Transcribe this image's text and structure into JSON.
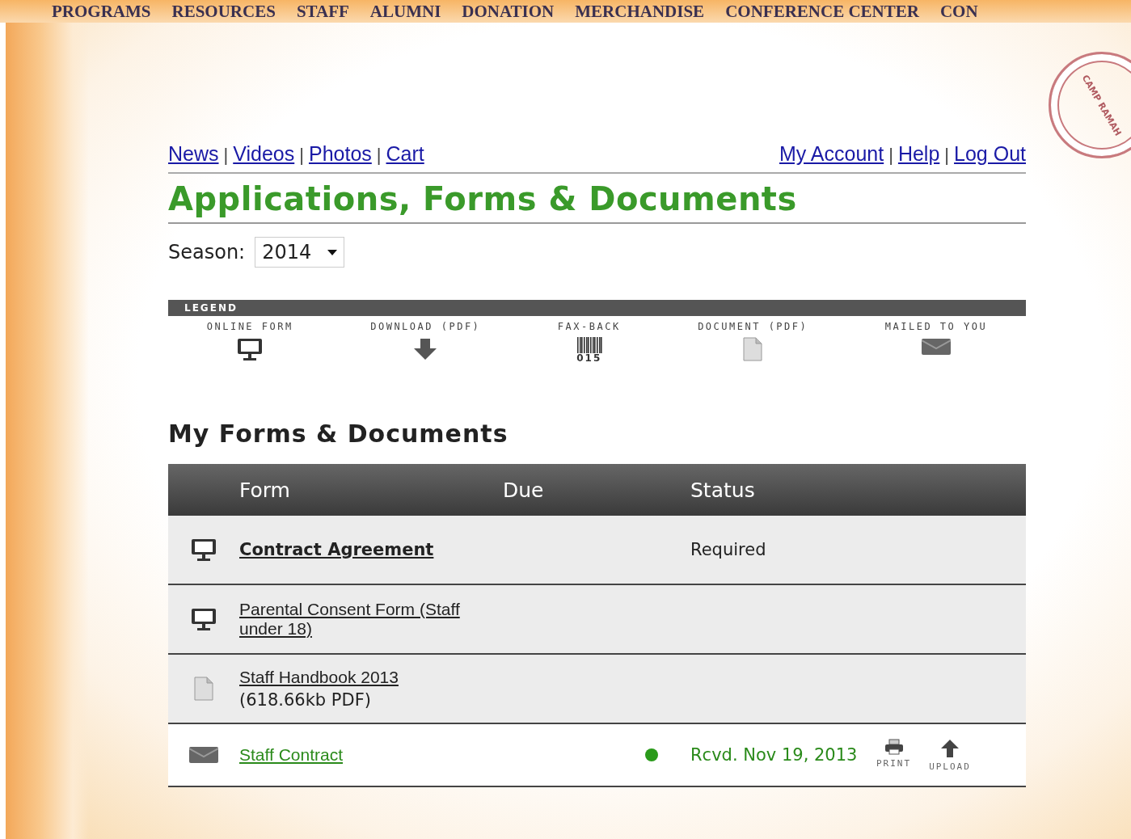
{
  "top_nav": [
    "PROGRAMS",
    "RESOURCES",
    "STAFF",
    "ALUMNI",
    "DONATION",
    "MERCHANDISE",
    "CONFERENCE CENTER",
    "CON"
  ],
  "stamp": {
    "text": "CAMP RAMAH"
  },
  "link_separator": "|",
  "links_left": [
    "News",
    "Videos",
    "Photos",
    "Cart"
  ],
  "links_right": [
    "My Account",
    "Help",
    "Log Out"
  ],
  "title": "Applications, Forms & Documents",
  "season": {
    "label": "Season:",
    "value": "2014"
  },
  "legend": {
    "title": "LEGEND",
    "items": [
      {
        "kind": "online",
        "label": "ONLINE FORM"
      },
      {
        "kind": "download",
        "label": "DOWNLOAD (PDF)"
      },
      {
        "kind": "fax",
        "label": "FAX-BACK",
        "code": "015"
      },
      {
        "kind": "document",
        "label": "DOCUMENT (PDF)"
      },
      {
        "kind": "mail",
        "label": "MAILED TO YOU"
      }
    ]
  },
  "section_title": "My Forms & Documents",
  "table": {
    "columns": [
      "Form",
      "Due",
      "Status"
    ],
    "rows": [
      {
        "kind": "online",
        "title": "Contract Agreement",
        "bold": true,
        "status": "Required",
        "received": false,
        "shaded": true
      },
      {
        "kind": "online",
        "title": "Parental Consent Form (Staff under 18)",
        "bold": false,
        "received": false,
        "shaded": true
      },
      {
        "kind": "document",
        "title": "Staff Handbook 2013",
        "bold": false,
        "note": "(618.66kb PDF)",
        "received": false,
        "shaded": true
      },
      {
        "kind": "mail",
        "title": "Staff Contract",
        "bold": false,
        "status": "Rcvd. Nov 19, 2013",
        "received": true,
        "color": "#2a9a1a",
        "shaded": false,
        "actions": [
          "PRINT",
          "UPLOAD"
        ]
      }
    ]
  }
}
